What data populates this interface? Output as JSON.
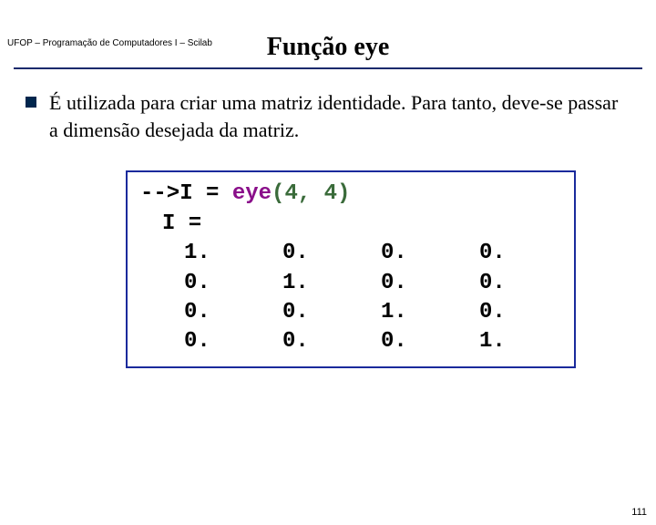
{
  "header": "UFOP – Programação de Computadores I – Scilab",
  "title": "Função eye",
  "bullet_text": "É utilizada para criar uma matriz identidade. Para tanto, deve-se passar a dimensão desejada da matriz.",
  "code": {
    "prompt": "-->",
    "assign": "I = ",
    "func": "eye",
    "args": "(4, 4)",
    "out_label": "I  =",
    "matrix": [
      [
        "1.",
        "0.",
        "0.",
        "0."
      ],
      [
        "0.",
        "1.",
        "0.",
        "0."
      ],
      [
        "0.",
        "0.",
        "1.",
        "0."
      ],
      [
        "0.",
        "0.",
        "0.",
        "1."
      ]
    ]
  },
  "page_number": "111"
}
